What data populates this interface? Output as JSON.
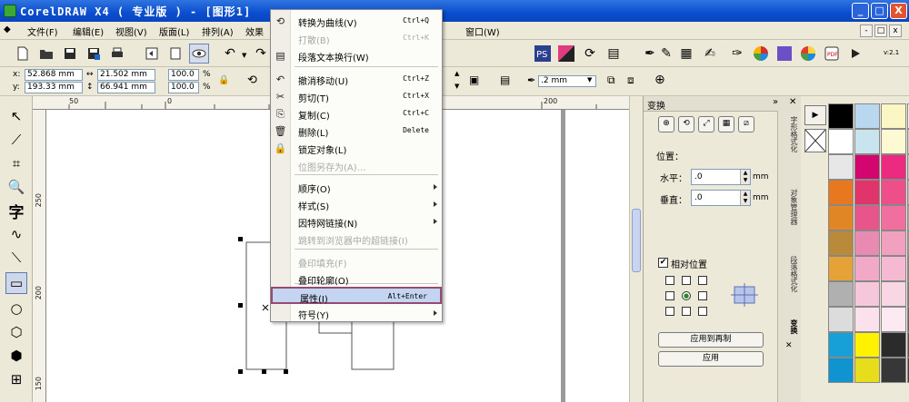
{
  "window": {
    "title": "CorelDRAW X4 ( 专业版 ) - [图形1]",
    "min": "_",
    "max": "□",
    "close": "X"
  },
  "menubar": {
    "items": [
      "文件(F)",
      "编辑(E)",
      "视图(V)",
      "版面(L)",
      "排列(A)",
      "效果",
      "窗口(W)"
    ],
    "mdi_buttons": [
      "-",
      "□",
      "x"
    ]
  },
  "toolbar": {
    "version_badge": "v:2.1"
  },
  "propbar": {
    "x_label": "x:",
    "x_value": "52.868 mm",
    "y_label": "y:",
    "y_value": "193.33 mm",
    "w_value": "21.502 mm",
    "h_value": "66.941 mm",
    "scale_x": "100.0",
    "scale_y": "100.0",
    "percent": "%",
    "outline_width": ".2 mm"
  },
  "ruler": {
    "h_labels": [
      "50",
      "0",
      "200"
    ],
    "v_labels": [
      "250",
      "200",
      "150"
    ]
  },
  "context_menu": {
    "items": [
      {
        "label": "转换为曲线(V)",
        "shortcut": "Ctrl+Q",
        "icon": "⟲",
        "disabled": false
      },
      {
        "label": "打散(B)",
        "shortcut": "Ctrl+K",
        "icon": "",
        "disabled": true
      },
      {
        "label": "段落文本换行(W)",
        "shortcut": "",
        "icon": "▤",
        "disabled": false
      },
      {
        "label": "撤消移动(U)",
        "shortcut": "Ctrl+Z",
        "icon": "↶",
        "disabled": false
      },
      {
        "label": "剪切(T)",
        "shortcut": "Ctrl+X",
        "icon": "✂",
        "disabled": false
      },
      {
        "label": "复制(C)",
        "shortcut": "Ctrl+C",
        "icon": "⎘",
        "disabled": false
      },
      {
        "label": "删除(L)",
        "shortcut": "Delete",
        "icon": "🗑",
        "disabled": false
      },
      {
        "label": "锁定对象(L)",
        "shortcut": "",
        "icon": "🔒",
        "disabled": false
      },
      {
        "label": "位图另存为(A)…",
        "shortcut": "",
        "icon": "",
        "disabled": true
      },
      {
        "label": "顺序(O)",
        "shortcut": "",
        "icon": "",
        "disabled": false,
        "submenu": true
      },
      {
        "label": "样式(S)",
        "shortcut": "",
        "icon": "",
        "disabled": false,
        "submenu": true
      },
      {
        "label": "因特网链接(N)",
        "shortcut": "",
        "icon": "",
        "disabled": false,
        "submenu": true
      },
      {
        "label": "跳转到浏览器中的超链接(I)",
        "shortcut": "",
        "icon": "",
        "disabled": true
      },
      {
        "label": "叠印填充(F)",
        "shortcut": "",
        "icon": "",
        "disabled": true
      },
      {
        "label": "叠印轮廓(O)",
        "shortcut": "",
        "icon": "",
        "disabled": false
      },
      {
        "label": "属性(I)",
        "shortcut": "Alt+Enter",
        "icon": "",
        "disabled": false,
        "hover": true
      },
      {
        "label": "符号(Y)",
        "shortcut": "",
        "icon": "",
        "disabled": false,
        "submenu": true
      }
    ]
  },
  "docker": {
    "title": "变换",
    "section_position": "位置：",
    "horizontal_label": "水平：",
    "horizontal_value": ".0",
    "vertical_label": "垂直：",
    "vertical_value": ".0",
    "unit": "mm",
    "relative_label": "相对位置",
    "relative_checked": true,
    "apply_copy": "应用到再制",
    "apply": "应用",
    "vertical_tabs": [
      "字形格式化",
      "对象管理器",
      "段落格式化",
      "变换"
    ]
  },
  "palette": {
    "colors": [
      "#000000",
      "#b9d7ee",
      "#fbf7c4",
      "#f2f2f2",
      "#ffffff",
      "#c8e4ef",
      "#fdf9d3",
      "#d0d0d0",
      "#e7e7e7",
      "#d2066e",
      "#ec2a7f",
      "#c7c7c7",
      "#e8781f",
      "#e0346b",
      "#ee4e8a",
      "#b7b7b7",
      "#e18625",
      "#e7558a",
      "#f06f9e",
      "#a7a7a7",
      "#b98a3a",
      "#e88ab2",
      "#f2a0bf",
      "#969696",
      "#e5a237",
      "#f1a9c7",
      "#f5b9d1",
      "#858585",
      "#b0b0b0",
      "#f6c7da",
      "#f9d6e4",
      "#747474",
      "#dcdcdc",
      "#fbe1ec",
      "#fce9f1",
      "#636363",
      "#17a0d8",
      "#fff200",
      "#2b2b2b",
      "#525252",
      "#0f94d0",
      "#e7dd1b",
      "#373737",
      "#414141"
    ]
  }
}
